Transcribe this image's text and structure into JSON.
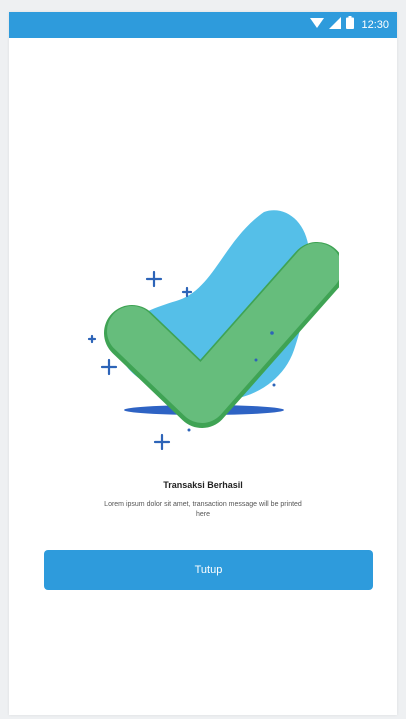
{
  "status_bar": {
    "time": "12:30",
    "icons": [
      "wifi-icon",
      "cell-signal-icon",
      "battery-icon"
    ]
  },
  "result": {
    "title": "Transaksi Berhasil",
    "message": "Lorem ipsum dolor sit amet, transaction message will be printed here"
  },
  "actions": {
    "close_label": "Tutup"
  },
  "colors": {
    "accent": "#2e9bdc",
    "check": "#5cb879",
    "blob": "#55bfe8",
    "sparkle": "#2d64b8"
  }
}
